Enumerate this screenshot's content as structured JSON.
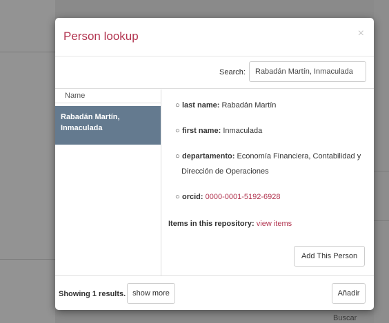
{
  "background": {
    "buscar_label": "Buscar"
  },
  "modal": {
    "title": "Person lookup",
    "close_symbol": "×",
    "search": {
      "label": "Search:",
      "value": "Rabadán Martín, Inmaculada"
    },
    "list": {
      "header": "Name",
      "items": [
        {
          "line1": "Rabadán Martín,",
          "line2": "Inmaculada"
        }
      ]
    },
    "details": {
      "last_name_label": "last name:",
      "last_name_value": "Rabadán Martín",
      "first_name_label": "first name:",
      "first_name_value": "Inmaculada",
      "departamento_label": "departamento:",
      "departamento_value_1": "Economía Financiera, Contabilidad y",
      "departamento_value_2": "Dirección de Operaciones",
      "orcid_label": "orcid:",
      "orcid_value": "0000-0001-5192-6928",
      "items_label": "Items in this repository:",
      "view_items": "view items",
      "add_button": "Add This Person"
    },
    "footer": {
      "showing": "Showing 1 results.",
      "show_more": "show more",
      "anadir": "Añadir"
    }
  },
  "colors": {
    "title": "#b23550",
    "selected_item": "#647a8f",
    "link": "#b23550"
  }
}
